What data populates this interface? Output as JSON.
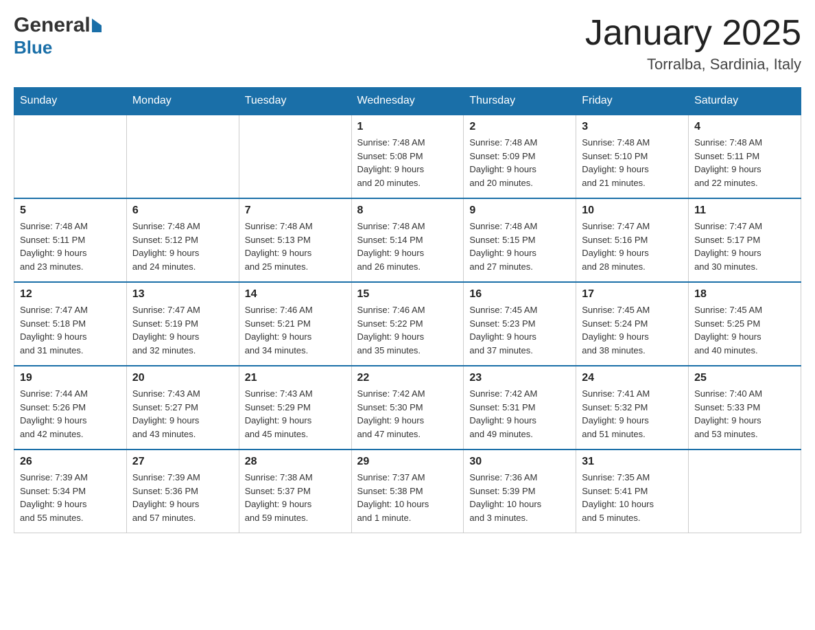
{
  "logo": {
    "general": "General",
    "blue": "Blue",
    "arrow_shape": "triangle-right"
  },
  "header": {
    "month_title": "January 2025",
    "location": "Torralba, Sardinia, Italy"
  },
  "days_of_week": [
    "Sunday",
    "Monday",
    "Tuesday",
    "Wednesday",
    "Thursday",
    "Friday",
    "Saturday"
  ],
  "weeks": [
    [
      {
        "day": "",
        "info": ""
      },
      {
        "day": "",
        "info": ""
      },
      {
        "day": "",
        "info": ""
      },
      {
        "day": "1",
        "info": "Sunrise: 7:48 AM\nSunset: 5:08 PM\nDaylight: 9 hours\nand 20 minutes."
      },
      {
        "day": "2",
        "info": "Sunrise: 7:48 AM\nSunset: 5:09 PM\nDaylight: 9 hours\nand 20 minutes."
      },
      {
        "day": "3",
        "info": "Sunrise: 7:48 AM\nSunset: 5:10 PM\nDaylight: 9 hours\nand 21 minutes."
      },
      {
        "day": "4",
        "info": "Sunrise: 7:48 AM\nSunset: 5:11 PM\nDaylight: 9 hours\nand 22 minutes."
      }
    ],
    [
      {
        "day": "5",
        "info": "Sunrise: 7:48 AM\nSunset: 5:11 PM\nDaylight: 9 hours\nand 23 minutes."
      },
      {
        "day": "6",
        "info": "Sunrise: 7:48 AM\nSunset: 5:12 PM\nDaylight: 9 hours\nand 24 minutes."
      },
      {
        "day": "7",
        "info": "Sunrise: 7:48 AM\nSunset: 5:13 PM\nDaylight: 9 hours\nand 25 minutes."
      },
      {
        "day": "8",
        "info": "Sunrise: 7:48 AM\nSunset: 5:14 PM\nDaylight: 9 hours\nand 26 minutes."
      },
      {
        "day": "9",
        "info": "Sunrise: 7:48 AM\nSunset: 5:15 PM\nDaylight: 9 hours\nand 27 minutes."
      },
      {
        "day": "10",
        "info": "Sunrise: 7:47 AM\nSunset: 5:16 PM\nDaylight: 9 hours\nand 28 minutes."
      },
      {
        "day": "11",
        "info": "Sunrise: 7:47 AM\nSunset: 5:17 PM\nDaylight: 9 hours\nand 30 minutes."
      }
    ],
    [
      {
        "day": "12",
        "info": "Sunrise: 7:47 AM\nSunset: 5:18 PM\nDaylight: 9 hours\nand 31 minutes."
      },
      {
        "day": "13",
        "info": "Sunrise: 7:47 AM\nSunset: 5:19 PM\nDaylight: 9 hours\nand 32 minutes."
      },
      {
        "day": "14",
        "info": "Sunrise: 7:46 AM\nSunset: 5:21 PM\nDaylight: 9 hours\nand 34 minutes."
      },
      {
        "day": "15",
        "info": "Sunrise: 7:46 AM\nSunset: 5:22 PM\nDaylight: 9 hours\nand 35 minutes."
      },
      {
        "day": "16",
        "info": "Sunrise: 7:45 AM\nSunset: 5:23 PM\nDaylight: 9 hours\nand 37 minutes."
      },
      {
        "day": "17",
        "info": "Sunrise: 7:45 AM\nSunset: 5:24 PM\nDaylight: 9 hours\nand 38 minutes."
      },
      {
        "day": "18",
        "info": "Sunrise: 7:45 AM\nSunset: 5:25 PM\nDaylight: 9 hours\nand 40 minutes."
      }
    ],
    [
      {
        "day": "19",
        "info": "Sunrise: 7:44 AM\nSunset: 5:26 PM\nDaylight: 9 hours\nand 42 minutes."
      },
      {
        "day": "20",
        "info": "Sunrise: 7:43 AM\nSunset: 5:27 PM\nDaylight: 9 hours\nand 43 minutes."
      },
      {
        "day": "21",
        "info": "Sunrise: 7:43 AM\nSunset: 5:29 PM\nDaylight: 9 hours\nand 45 minutes."
      },
      {
        "day": "22",
        "info": "Sunrise: 7:42 AM\nSunset: 5:30 PM\nDaylight: 9 hours\nand 47 minutes."
      },
      {
        "day": "23",
        "info": "Sunrise: 7:42 AM\nSunset: 5:31 PM\nDaylight: 9 hours\nand 49 minutes."
      },
      {
        "day": "24",
        "info": "Sunrise: 7:41 AM\nSunset: 5:32 PM\nDaylight: 9 hours\nand 51 minutes."
      },
      {
        "day": "25",
        "info": "Sunrise: 7:40 AM\nSunset: 5:33 PM\nDaylight: 9 hours\nand 53 minutes."
      }
    ],
    [
      {
        "day": "26",
        "info": "Sunrise: 7:39 AM\nSunset: 5:34 PM\nDaylight: 9 hours\nand 55 minutes."
      },
      {
        "day": "27",
        "info": "Sunrise: 7:39 AM\nSunset: 5:36 PM\nDaylight: 9 hours\nand 57 minutes."
      },
      {
        "day": "28",
        "info": "Sunrise: 7:38 AM\nSunset: 5:37 PM\nDaylight: 9 hours\nand 59 minutes."
      },
      {
        "day": "29",
        "info": "Sunrise: 7:37 AM\nSunset: 5:38 PM\nDaylight: 10 hours\nand 1 minute."
      },
      {
        "day": "30",
        "info": "Sunrise: 7:36 AM\nSunset: 5:39 PM\nDaylight: 10 hours\nand 3 minutes."
      },
      {
        "day": "31",
        "info": "Sunrise: 7:35 AM\nSunset: 5:41 PM\nDaylight: 10 hours\nand 5 minutes."
      },
      {
        "day": "",
        "info": ""
      }
    ]
  ],
  "colors": {
    "header_bg": "#1a6fa8",
    "header_text": "#ffffff",
    "border_top": "#1a6fa8",
    "text_primary": "#222222",
    "text_secondary": "#333333"
  }
}
